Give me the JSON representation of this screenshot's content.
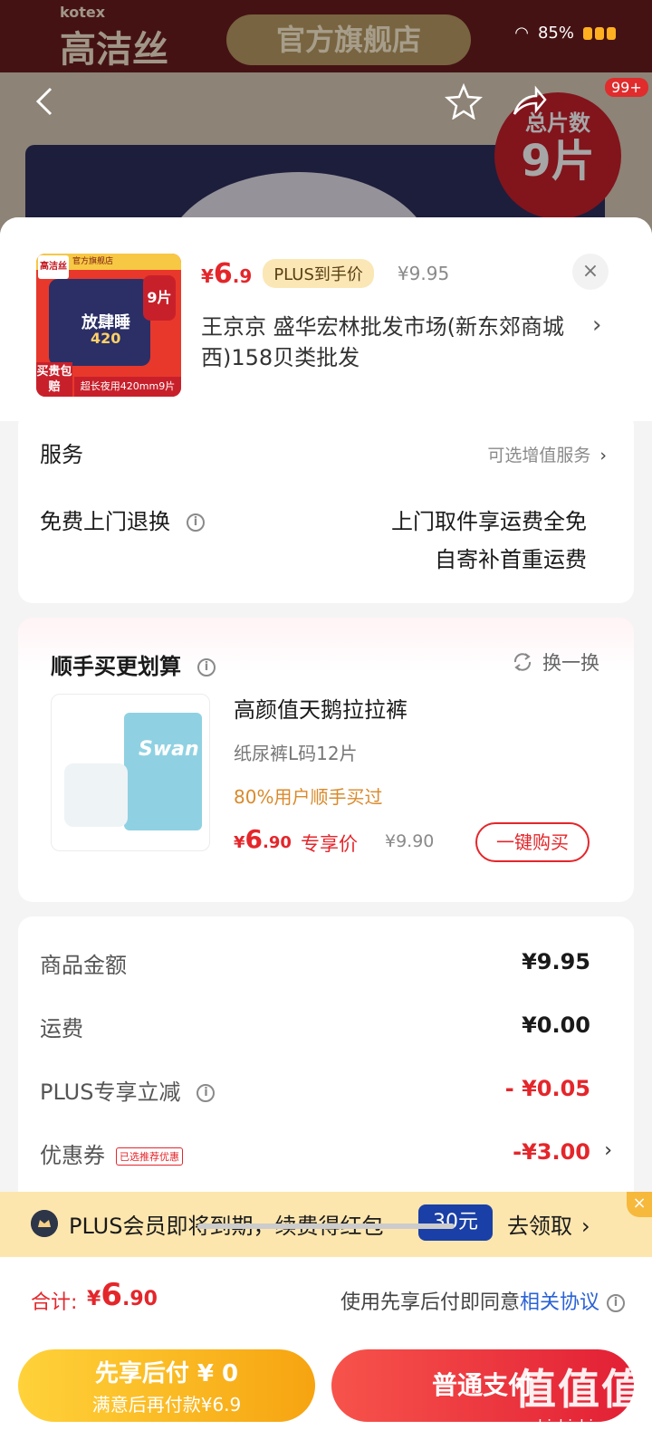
{
  "background": {
    "brand_latin": "kotex",
    "brand_cn": "高洁丝",
    "flagship": "官方旗舰店",
    "count_label": "总片数",
    "count_value": "9片",
    "cart_badge": "99+"
  },
  "status_bar": {
    "battery": "85%"
  },
  "sheet": {
    "thumbnail": {
      "brand": "高洁丝",
      "store": "官方旗舰店",
      "title": "放肆睡",
      "size": "420",
      "count": "9片",
      "buy_tag": "买贵包赔",
      "caption": "超长夜用420mm9片"
    },
    "price": {
      "currency": "¥",
      "integer": "6",
      "decimal": ".9",
      "plus_tag": "PLUS到手价",
      "original": "¥9.95"
    },
    "close": "×",
    "address": "王京京  盛华宏林批发市场(新东郊商城西)158贝类批发",
    "service": {
      "title": "服务",
      "optional": "可选增值服务",
      "return_label": "免费上门退换",
      "line1": "上门取件享运费全免",
      "line2": "自寄补首重运费"
    },
    "upsell": {
      "title": "顺手买更划算",
      "swap": "换一换",
      "pack_text": "Swan",
      "name": "高颜值天鹅拉拉裤",
      "spec": "纸尿裤L码12片",
      "bought": "80%用户顺手买过",
      "price_currency": "¥",
      "price_integer": "6",
      "price_decimal": ".90",
      "exclusive": "专享价",
      "original": "¥9.90",
      "buy_button": "一键购买"
    },
    "totals": [
      {
        "label": "商品金额",
        "value": "¥9.95"
      },
      {
        "label": "运费",
        "value": "¥0.00"
      },
      {
        "label": "PLUS专享立减",
        "value": "- ¥0.05"
      },
      {
        "label": "优惠券",
        "tag": "已选推荐优惠",
        "value": "-¥3.00"
      }
    ],
    "plus_banner": {
      "text": "PLUS会员即将到期，续费得红包",
      "amount": "30元",
      "claim": "去领取",
      "close": "×"
    },
    "footer": {
      "total_label": "合计:",
      "total_currency": "¥",
      "total_integer": "6",
      "total_decimal": ".90",
      "agree_text": "使用先享后付即同意",
      "agree_link": "相关协议",
      "later_line1": "先享后付 ¥ 0",
      "later_line2": "满意后再付款¥6.9",
      "pay_button": "普通支付"
    }
  },
  "watermark": {
    "big": "值值值",
    "small": "zhizhizhi.com"
  },
  "colors": {
    "accent_red": "#e4262b",
    "plus_gold": "#fde6ae",
    "link_blue": "#2a62d6"
  }
}
